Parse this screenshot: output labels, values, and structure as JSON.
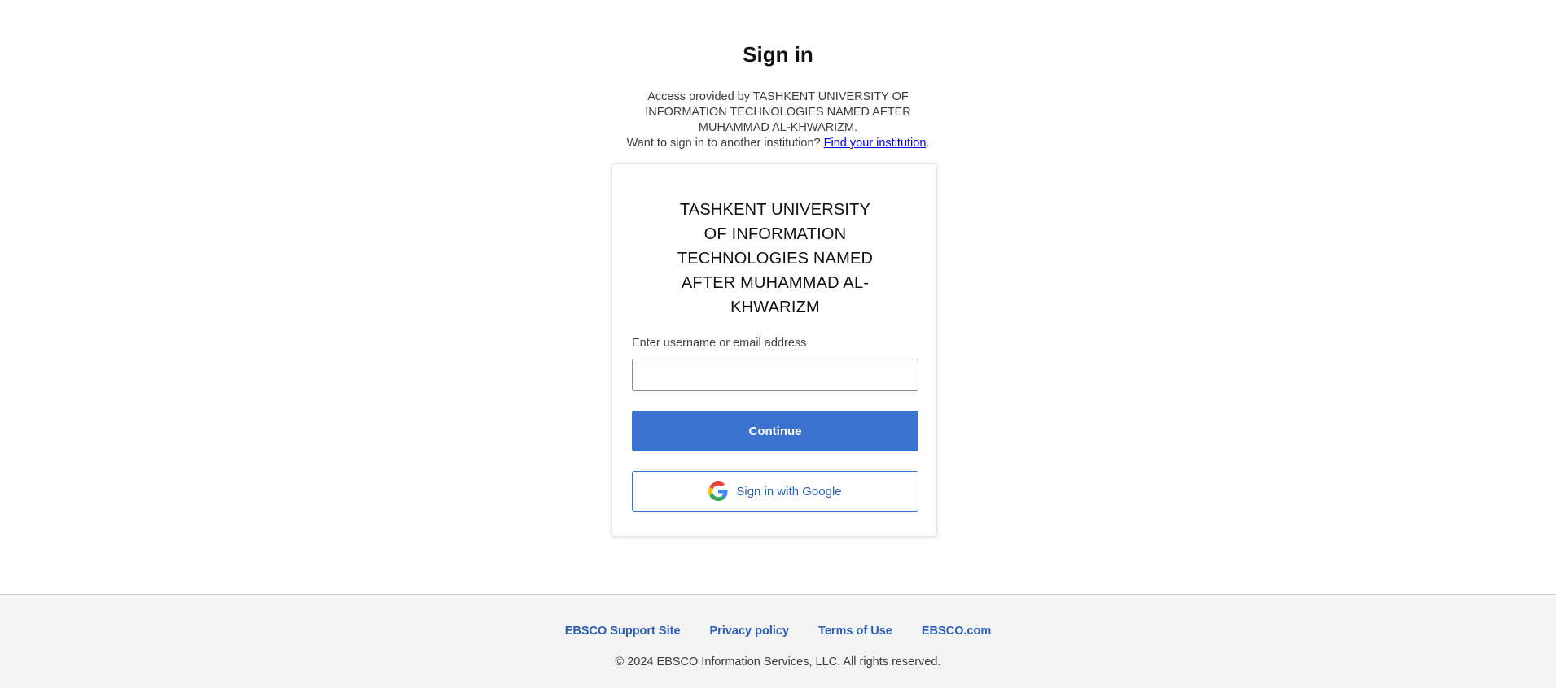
{
  "page": {
    "title": "Sign in"
  },
  "access": {
    "prefix": "Access provided by ",
    "institution": "TASHKENT UNIVERSITY OF INFORMATION TECHNOLOGIES NAMED AFTER MUHAMMAD AL-KHWARIZM.",
    "other_prefix": "Want to sign in to another institution? ",
    "find_link": "Find your institution",
    "other_suffix": "."
  },
  "card": {
    "institution_name": "TASHKENT UNIVERSITY OF INFORMATION TECHNOLOGIES NAMED AFTER MUHAMMAD AL-KHWARIZM",
    "username_label": "Enter username or email address",
    "username_value": "",
    "continue_label": "Continue",
    "google_label": "Sign in with Google"
  },
  "footer": {
    "links": [
      "EBSCO Support Site",
      "Privacy policy",
      "Terms of Use",
      "EBSCO.com"
    ],
    "copyright": "© 2024 EBSCO Information Services, LLC. All rights reserved."
  },
  "colors": {
    "primary": "#3b73cf",
    "link": "#2a5fb5",
    "footer_bg": "#f4f4f5"
  },
  "icons": {
    "google": "google-g-icon"
  }
}
